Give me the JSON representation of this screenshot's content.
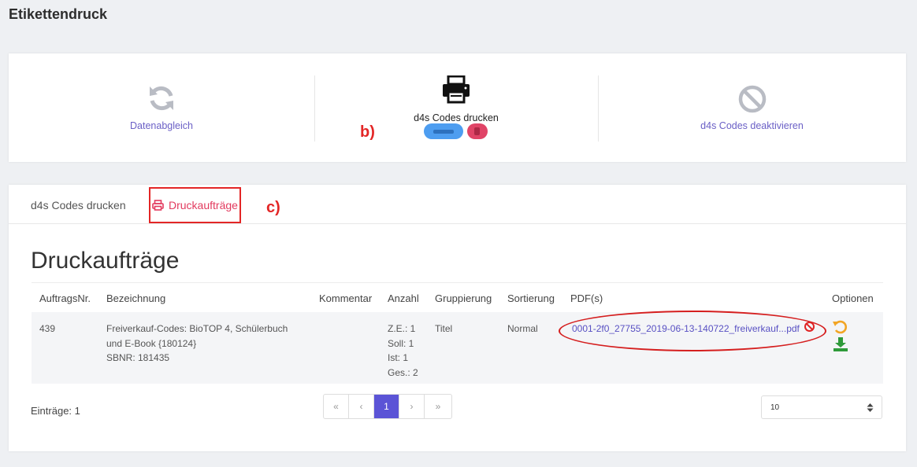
{
  "page": {
    "title": "Etikettendruck"
  },
  "actions": {
    "sync": {
      "label": "Datenabgleich",
      "icon": "sync-icon"
    },
    "print": {
      "label": "d4s Codes drucken",
      "icon": "printer-icon"
    },
    "deactivate": {
      "label": "d4s Codes deaktivieren",
      "icon": "ban-icon"
    }
  },
  "annotations": {
    "b": "b)",
    "c": "c)"
  },
  "tabs": [
    {
      "label": "d4s Codes drucken",
      "active": false
    },
    {
      "label": "Druckaufträge",
      "active": true,
      "icon": "printer-icon"
    }
  ],
  "section": {
    "title": "Druckaufträge"
  },
  "table": {
    "headers": [
      "AuftragsNr.",
      "Bezeichnung",
      "Kommentar",
      "Anzahl",
      "Gruppierung",
      "Sortierung",
      "PDF(s)",
      "Optionen"
    ],
    "rows": [
      {
        "nr": "439",
        "bezeichnung": [
          "Freiverkauf-Codes: BioTOP 4, Schülerbuch",
          "und E-Book {180124}",
          "SBNR: 181435"
        ],
        "kommentar": "",
        "anzahl": [
          "Z.E.: 1",
          "Soll: 1",
          "Ist: 1",
          "Ges.: 2"
        ],
        "gruppierung": "Titel",
        "sortierung": "Normal",
        "pdf": "0001-2f0_27755_2019-06-13-140722_freiverkauf...pdf"
      }
    ]
  },
  "footer": {
    "entries": "Einträge: 1"
  },
  "pagination": {
    "first": "«",
    "prev": "‹",
    "current": "1",
    "next": "›",
    "last": "»"
  },
  "page_size": {
    "value": "10"
  },
  "colors": {
    "accent": "#5b54d6",
    "link": "#6b60c6",
    "tab_active": "#e23a5e",
    "annotation": "#e32626"
  }
}
